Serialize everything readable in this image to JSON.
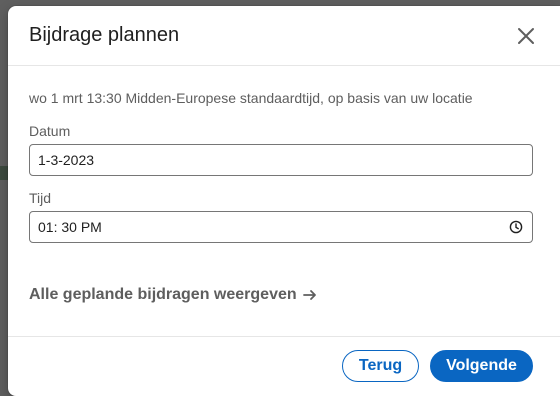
{
  "dialog": {
    "title": "Bijdrage plannen",
    "close_icon": "close-icon"
  },
  "info_text": "wo 1 mrt 13:30 Midden-Europese standaardtijd, op basis van uw locatie",
  "date_field": {
    "label": "Datum",
    "value": "1-3-2023"
  },
  "time_field": {
    "label": "Tijd",
    "value": "01: 30 PM",
    "icon": "clock-icon"
  },
  "link": {
    "label": "Alle geplande bijdragen weergeven",
    "icon": "arrow-right-icon"
  },
  "footer": {
    "back_label": "Terug",
    "next_label": "Volgende"
  },
  "colors": {
    "accent": "#0a66c2",
    "muted_text": "#5e5e5e",
    "overlay": "#5f5f5f"
  }
}
